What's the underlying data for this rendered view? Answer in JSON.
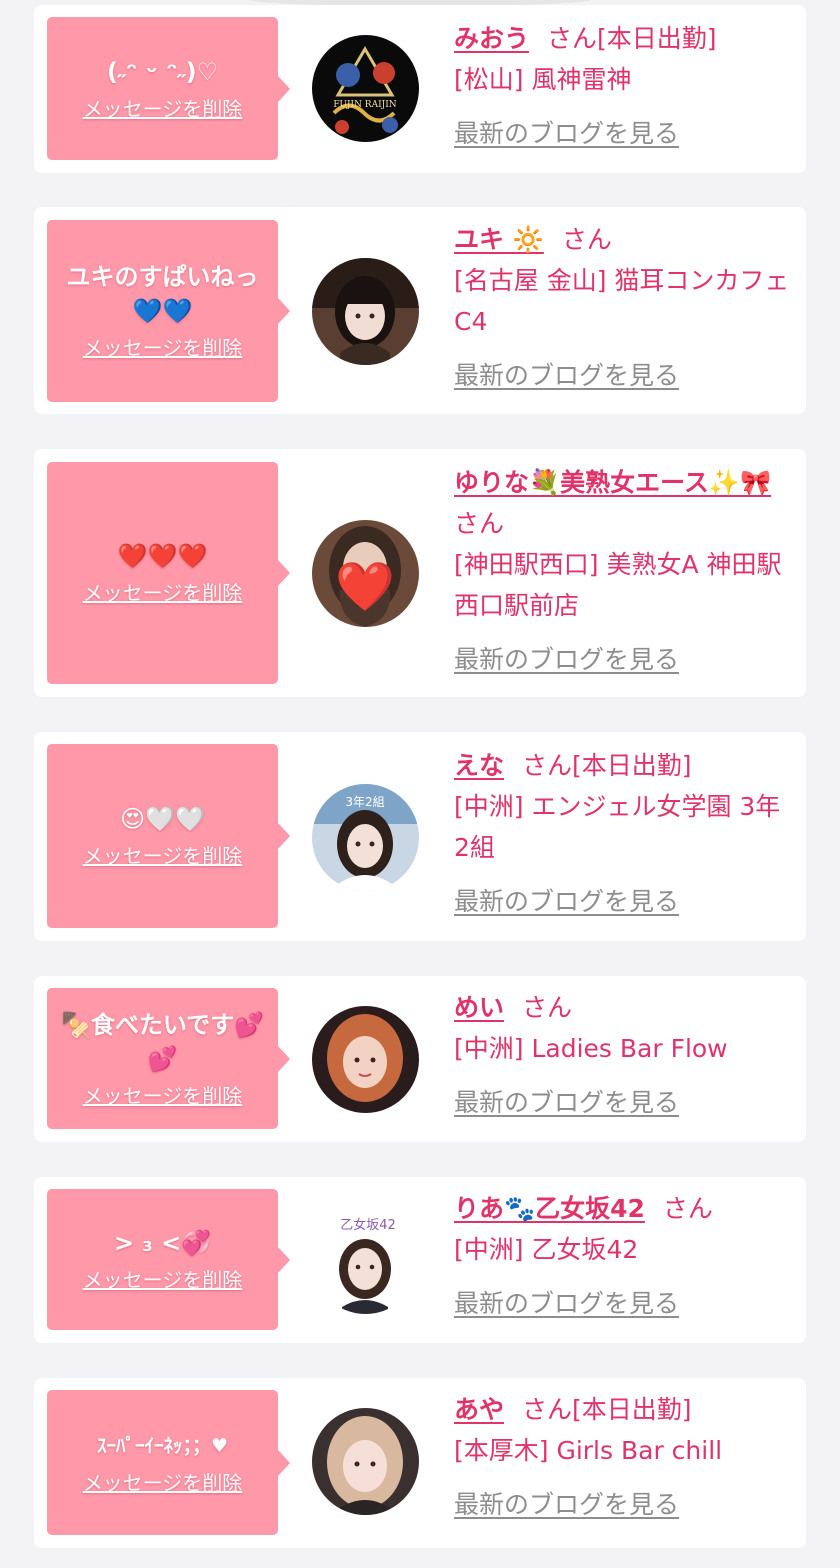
{
  "ui": {
    "san": "さん",
    "delete_label": "メッセージを削除",
    "blog_label": "最新のブログを見る"
  },
  "items": [
    {
      "message": "(˶ᵔ ᵕ ᵔ˶)♡",
      "name": "みおう",
      "status": "[本日出勤]",
      "shop": "[松山] 風神雷神",
      "avatar_label": "FUJIN RAIJIN"
    },
    {
      "message": "ユキのすぱいねっ💙💙",
      "name": "ユキ 🔆",
      "status": "",
      "shop": "[名古屋 金山] 猫耳コンカフェ C4"
    },
    {
      "message": "❤️❤️❤️",
      "name": "ゆりな💐美熟女エース✨🎀",
      "status": "",
      "shop": "[神田駅西口] 美熟女A 神田駅西口駅前店",
      "avatar_sticker": "❤️"
    },
    {
      "message": "😍🤍🤍",
      "name": "えな",
      "status": "[本日出勤]",
      "shop": "[中洲] エンジェル女学園 3年2組",
      "avatar_label": "3年2組"
    },
    {
      "message": "🍢食べたいです💕💕",
      "name": "めい",
      "status": "",
      "shop": "[中洲] Ladies Bar Flow"
    },
    {
      "message": "> ₃ <💞",
      "name": "りあ🐾乙女坂42",
      "status": "",
      "shop": "[中洲] 乙女坂42",
      "avatar_label": "乙女坂42"
    },
    {
      "message": "ｽｰﾊﾟｰｲｰﾈｯ；；♥",
      "name": "あや",
      "status": "[本日出勤]",
      "shop": "[本厚木] Girls Bar chill"
    }
  ],
  "colors": {
    "accent_pink": "#e0336a",
    "bubble_pink": "#ff98a8",
    "link_gray": "#8d8d8d",
    "background": "#f3f3f5"
  }
}
